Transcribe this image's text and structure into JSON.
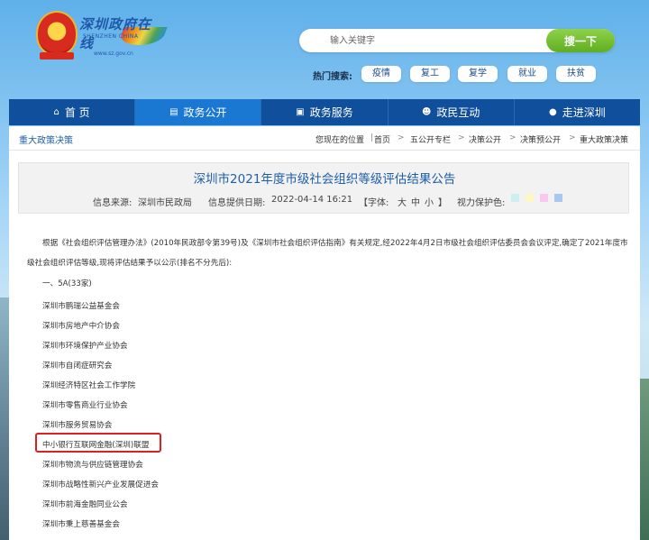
{
  "site": {
    "logo_title": "深圳政府在线",
    "logo_sub": "SHENZHEN CHINA",
    "logo_url": "www.sz.gov.cn"
  },
  "search": {
    "placeholder": "输入关键字",
    "button_label": "搜一下",
    "hot_label": "热门搜索:",
    "hot_tags": [
      "疫情",
      "复工",
      "复学",
      "就业",
      "扶贫"
    ]
  },
  "nav": [
    {
      "label": "首 页",
      "icon": "home-icon"
    },
    {
      "label": "政务公开",
      "icon": "newspaper-icon"
    },
    {
      "label": "政务服务",
      "icon": "service-icon"
    },
    {
      "label": "政民互动",
      "icon": "people-icon"
    },
    {
      "label": "走进深圳",
      "icon": "bulb-icon"
    }
  ],
  "breadcrumb": {
    "section_title": "重大政策决策",
    "location_label": "您现在的位置",
    "items": [
      "首页",
      "五公开专栏",
      "决策公开",
      "决策预公开",
      "重大政策决策"
    ],
    "separator": ">"
  },
  "article": {
    "title": "深圳市2021年度市级社会组织等级评估结果公告",
    "source_label": "信息来源:",
    "source": "深圳市民政局",
    "date_label": "信息提供日期:",
    "date": "2022-04-14 16:21",
    "font_label": "【字体:",
    "font_sizes": [
      "大",
      "中",
      "小"
    ],
    "font_close": "】",
    "eye_label": "视力保护色:",
    "eye_colors": [
      "#ccf0f0",
      "#fcf8c0",
      "#f8c8f0",
      "#a8c8f0"
    ],
    "intro_line1": "根据《社会组织评估管理办法》(2010年民政部令第39号)及《深圳市社会组织评估指南》有关规定,经2022年4月2日市级社会组织评估委员会会议评定,确定了2021年度市",
    "intro_line2": "级社会组织评估等级,现将评估结果予以公示(排名不分先后):",
    "grade_heading": "一、5A(33家)",
    "orgs": [
      "深圳市鹏瑞公益基金会",
      "深圳市房地产中介协会",
      "深圳市环境保护产业协会",
      "深圳市自闭症研究会",
      "深圳经济特区社会工作学院",
      "深圳市零售商业行业协会",
      "深圳市服务贸易协会",
      "中小银行互联网金融(深圳)联盟",
      "深圳市物流与供应链管理协会",
      "深圳市战略性新兴产业发展促进会",
      "深圳市前海金融同业公会",
      "深圳市秉上慈善基金会"
    ]
  }
}
